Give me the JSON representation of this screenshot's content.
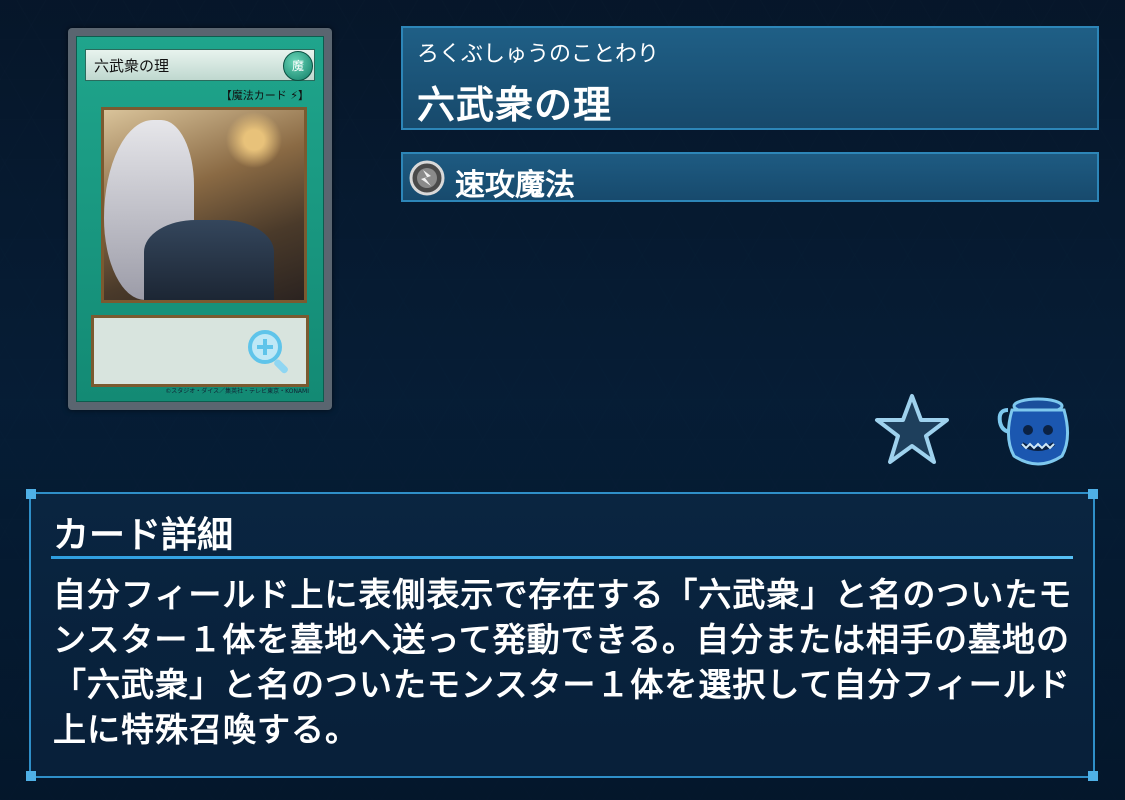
{
  "card": {
    "name_small": "六武衆の理",
    "attribute": "魔",
    "type_line": "【魔法カード",
    "copyright": "©スタジオ・ダイス／集英社・テレビ東京・KONAMI"
  },
  "card_info": {
    "reading": "ろくぶしゅうのことわり",
    "name": "六武衆の理",
    "type": "速攻魔法"
  },
  "icons": {
    "favorite": "star-icon",
    "pot": "pot-of-greed-icon",
    "zoom": "zoom-plus-icon",
    "quick_play": "quick-play-spell-icon"
  },
  "detail": {
    "title": "カード詳細",
    "text": "自分フィールド上に表側表示で存在する「六武衆」と名のついたモンスター１体を墓地へ送って発動できる。自分または相手の墓地の「六武衆」と名のついたモンスター１体を選択して自分フィールド上に特殊召喚する。"
  },
  "colors": {
    "accent": "#2f8fc8",
    "card_green": "#1fa58c"
  }
}
